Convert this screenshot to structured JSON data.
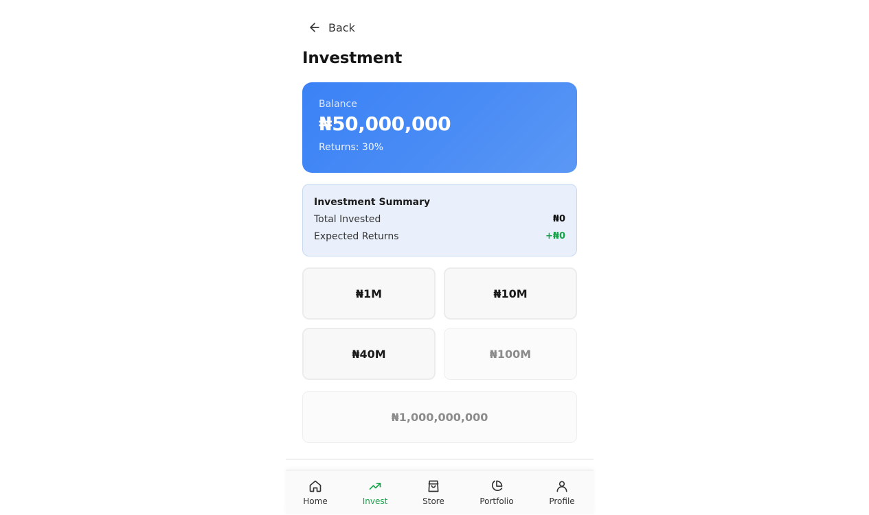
{
  "header": {
    "back_label": "Back",
    "title": "Investment"
  },
  "balance": {
    "label": "Balance",
    "amount": "₦50,000,000",
    "returns": "Returns: 30%"
  },
  "summary": {
    "title": "Investment Summary",
    "rows": [
      {
        "label": "Total Invested",
        "value": "₦0"
      },
      {
        "label": "Expected Returns",
        "value": "+₦0"
      }
    ]
  },
  "options": [
    {
      "label": "₦1M",
      "enabled": true
    },
    {
      "label": "₦10M",
      "enabled": true
    },
    {
      "label": "₦40M",
      "enabled": true
    },
    {
      "label": "₦100M",
      "enabled": false
    },
    {
      "label": "₦1,000,000,000",
      "enabled": false
    }
  ],
  "nav": {
    "items": [
      {
        "label": "Home",
        "icon": "home-icon"
      },
      {
        "label": "Invest",
        "icon": "trending-up-icon",
        "active": true
      },
      {
        "label": "Store",
        "icon": "shopping-bag-icon"
      },
      {
        "label": "Portfolio",
        "icon": "pie-chart-icon"
      },
      {
        "label": "Profile",
        "icon": "user-icon"
      }
    ]
  },
  "colors": {
    "accent_blue": "#3b82f6",
    "active_green": "#16a34a",
    "summary_bg": "#e9f0fb"
  }
}
